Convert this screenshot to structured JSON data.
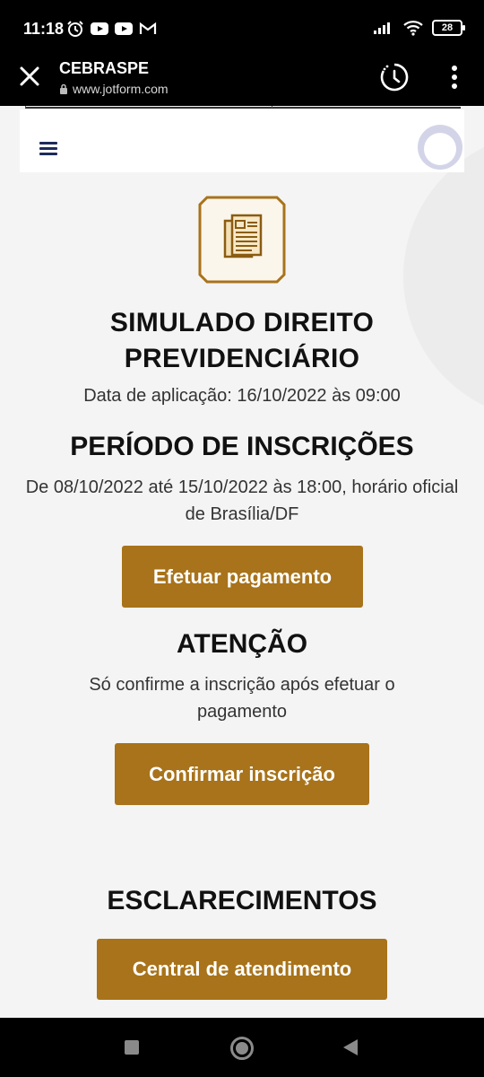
{
  "status_bar": {
    "time": "11:18",
    "battery": "28",
    "icons_left": [
      "alarm-icon",
      "youtube-icon",
      "youtube-icon",
      "gmail-icon"
    ],
    "icons_right": [
      "signal-icon",
      "wifi-icon",
      "battery-icon"
    ]
  },
  "browser": {
    "title": "CEBRASPE",
    "url": "www.jotform.com"
  },
  "colors": {
    "accent": "#a8731a",
    "heading": "#111111",
    "menu": "#1d2a5b"
  },
  "page": {
    "title": "SIMULADO DIREITO PREVIDENCIÁRIO",
    "date_line": "Data de aplicação: 16/10/2022 às 09:00",
    "period_heading": "PERÍODO DE INSCRIÇÕES",
    "period_text": "De 08/10/2022 até 15/10/2022 às 18:00, horário oficial de Brasília/DF",
    "pay_button": "Efetuar pagamento",
    "attention_heading": "ATENÇÃO",
    "attention_text": "Só confirme a inscrição após efetuar o pagamento",
    "confirm_button": "Confirmar inscrição",
    "clarifications_heading": "ESCLARECIMENTOS",
    "support_button": "Central de atendimento"
  }
}
